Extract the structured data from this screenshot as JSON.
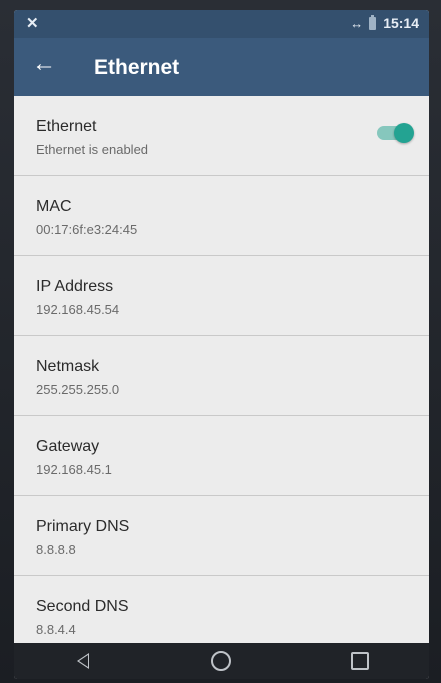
{
  "status_bar": {
    "left_icon": "signal-off-icon",
    "sync_glyph": "↔",
    "time": "15:14"
  },
  "app_bar": {
    "title": "Ethernet",
    "back_icon": "arrow-back-icon"
  },
  "items": [
    {
      "title": "Ethernet",
      "subtitle": "Ethernet is enabled",
      "toggle_on": true
    },
    {
      "title": "MAC",
      "subtitle": "00:17:6f:e3:24:45"
    },
    {
      "title": "IP Address",
      "subtitle": "192.168.45.54"
    },
    {
      "title": "Netmask",
      "subtitle": "255.255.255.0"
    },
    {
      "title": "Gateway",
      "subtitle": "192.168.45.1"
    },
    {
      "title": "Primary DNS",
      "subtitle": "8.8.8.8"
    },
    {
      "title": "Second DNS",
      "subtitle": "8.8.4.4"
    }
  ],
  "nav_bar": {
    "back": "nav-back-icon",
    "home": "nav-home-icon",
    "recents": "nav-recents-icon"
  },
  "colors": {
    "status_bar": "#34506e",
    "app_bar": "#3b5a7c",
    "toggle_accent": "#23a392",
    "list_background": "#ececec"
  }
}
